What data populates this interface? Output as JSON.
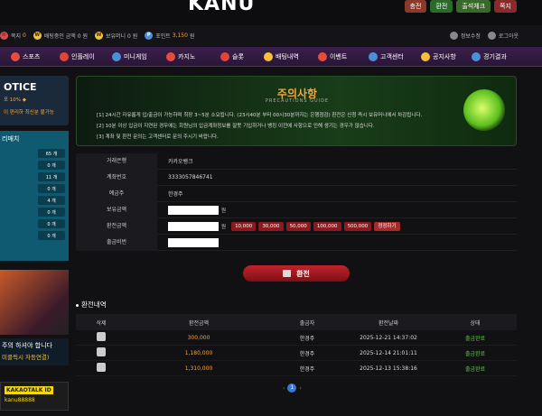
{
  "header": {
    "logo": "KANU",
    "buttons": [
      "충전",
      "환전",
      "출석체크",
      "쪽지"
    ],
    "info": {
      "points_label": "쪽지",
      "points_value": "0",
      "betting_label": "배팅중인 금액",
      "betting_value": "0 원",
      "bonus_label": "보유머니",
      "bonus_value": "0 원",
      "point_label": "포인트",
      "point_value": "3,150",
      "point_unit": "원",
      "account_info": "정보수정",
      "logout": "로그아웃"
    }
  },
  "nav": [
    {
      "label": "스포츠",
      "color": "#e74c3c"
    },
    {
      "label": "인플레이",
      "color": "#e0453a"
    },
    {
      "label": "미니게임",
      "color": "#4a90d9"
    },
    {
      "label": "카지노",
      "color": "#e74c3c"
    },
    {
      "label": "슬롯",
      "color": "#e0453a"
    },
    {
      "label": "배팅내역",
      "color": "#f2c23c"
    },
    {
      "label": "이벤트",
      "color": "#e74c3c"
    },
    {
      "label": "고객센터",
      "color": "#4a90d9"
    },
    {
      "label": "공지사항",
      "color": "#f2c23c"
    },
    {
      "label": "경기결과",
      "color": "#4a90d9"
    }
  ],
  "sidebar": {
    "notice_title": "OTICE",
    "notice_sub": "포 10% ◆",
    "notice_line": "이 편리하 최신분 불가능",
    "live_title": "리매치",
    "live_counts": [
      "65 개",
      "0 개",
      "11 개",
      "0 개",
      "4 개",
      "0 개",
      "0 개",
      "0 개"
    ],
    "banner2_title": "주의 하셔야 합니다",
    "banner2_sub": "미클릭시 자동연결)",
    "kakao_label": "KAKAOTALK ID",
    "kakao_id": "kanu88888"
  },
  "guide": {
    "title": "주의사항",
    "subtitle": "PRECAUTIONS GUIDE",
    "lines": [
      "[1]  24시간 자유롭게 입/출금이 가능하며 최장 3~5분 소요됩니다. (23시40분 부터 00시30분까지는 은행점검) 환전은 신청 즉시 보유머니에서 차감됩니다.",
      "[2]  10분 이상 입금이 지연된 경우에는 회원님의 입금계좌정보를 잘못 기입하거나 뱅킹 이전에 사항으로 인해 생기는 경우가 많습니다.",
      "[3]  계좌 및 환전 문의는 고객센터로 문의 주시기 바랍니다."
    ]
  },
  "form": {
    "bank_label": "거래은행",
    "bank_value": "카카오뱅크",
    "account_label": "계좌번호",
    "account_value": "3333057846741",
    "holder_label": "예금주",
    "holder_value": "한경주",
    "balance_label": "보유금액",
    "balance_unit": "원",
    "amount_label": "환전금액",
    "amount_unit": "원",
    "amount_buttons": [
      "10,000",
      "30,000",
      "50,000",
      "100,000",
      "500,000"
    ],
    "reset_button": "정정하기",
    "password_label": "출금비번",
    "submit": "환전"
  },
  "history": {
    "title": "환전내역",
    "headers": [
      "삭제",
      "환전금액",
      "출금자",
      "환전날짜",
      "상태"
    ],
    "rows": [
      {
        "amount": "300,000",
        "name": "한경주",
        "date": "2025-12-21 14:37:02",
        "status": "출금완료"
      },
      {
        "amount": "1,180,000",
        "name": "한경주",
        "date": "2025-12-14 21:01:11",
        "status": "출금완료"
      },
      {
        "amount": "1,310,000",
        "name": "한경주",
        "date": "2025-12-13 15:38:16",
        "status": "출금완료"
      }
    ],
    "page": "1"
  }
}
